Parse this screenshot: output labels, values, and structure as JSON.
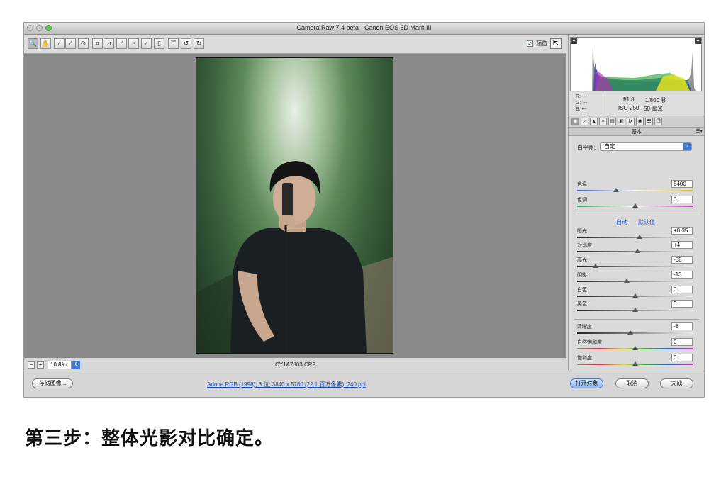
{
  "window": {
    "title": "Camera Raw 7.4 beta -  Canon EOS 5D Mark III"
  },
  "toolbar": {
    "tools": [
      {
        "icon": "zoom-icon",
        "glyph": "🔍"
      },
      {
        "icon": "hand-icon",
        "glyph": "✋"
      },
      {
        "icon": "white-balance-icon",
        "glyph": "⁄"
      },
      {
        "icon": "color-sampler-icon",
        "glyph": "⁄"
      },
      {
        "icon": "target-adjust-icon",
        "glyph": "⊙"
      },
      {
        "icon": "crop-icon",
        "glyph": "⌗"
      },
      {
        "icon": "straighten-icon",
        "glyph": "⊿"
      },
      {
        "icon": "spot-removal-icon",
        "glyph": "⁄"
      },
      {
        "icon": "red-eye-icon",
        "glyph": "◔"
      },
      {
        "icon": "adjustment-brush-icon",
        "glyph": "⁄"
      },
      {
        "icon": "graduated-filter-icon",
        "glyph": "▯"
      },
      {
        "icon": "preferences-icon",
        "glyph": "☰"
      },
      {
        "icon": "rotate-left-icon",
        "glyph": "↺"
      },
      {
        "icon": "rotate-right-icon",
        "glyph": "↻"
      }
    ],
    "preview_label": "预览"
  },
  "image": {
    "filename": "CY1A7803.CR2"
  },
  "zoom": {
    "value": "10.8%"
  },
  "info": {
    "r_label": "R:",
    "r_value": "---",
    "g_label": "G:",
    "g_value": "---",
    "b_label": "B:",
    "b_value": "---",
    "aperture": "f/1.8",
    "shutter": "1/800 秒",
    "iso": "ISO 250",
    "focal": "50 毫米"
  },
  "panel": {
    "title": "基本",
    "menu": "☰▾",
    "tabs": [
      "◉",
      "◿",
      "▲",
      "≡",
      "▤",
      "◧",
      "fx",
      "◉",
      "☷",
      "❐"
    ],
    "white_balance_label": "白平衡:",
    "white_balance_value": "自定",
    "auto_link": "自动",
    "default_link": "默认值",
    "sliders": [
      {
        "label": "色温",
        "value": "5400",
        "position": 0.34,
        "track": "temp"
      },
      {
        "label": "色调",
        "value": "0",
        "position": 0.5,
        "track": "tint"
      },
      {
        "label": "曝光",
        "value": "+0.35",
        "position": 0.54,
        "track": "gray"
      },
      {
        "label": "对比度",
        "value": "+4",
        "position": 0.52,
        "track": "gray"
      },
      {
        "label": "高光",
        "value": "-68",
        "position": 0.16,
        "track": "gray"
      },
      {
        "label": "阴影",
        "value": "-13",
        "position": 0.43,
        "track": "gray"
      },
      {
        "label": "白色",
        "value": "0",
        "position": 0.5,
        "track": "gray"
      },
      {
        "label": "黑色",
        "value": "0",
        "position": 0.5,
        "track": "gray"
      },
      {
        "label": "清晰度",
        "value": "-8",
        "position": 0.46,
        "track": "gray"
      },
      {
        "label": "自然饱和度",
        "value": "0",
        "position": 0.5,
        "track": "sat"
      },
      {
        "label": "饱和度",
        "value": "0",
        "position": 0.5,
        "track": "sat"
      }
    ]
  },
  "footer": {
    "save_label": "存储图像...",
    "workflow": "Adobe RGB (1998); 8 位;  3840 x 5760 (22.1 百万像素); 240 ppi",
    "open_label": "打开对象",
    "cancel_label": "取消",
    "done_label": "完成"
  },
  "caption": "第三步：整体光影对比确定。"
}
